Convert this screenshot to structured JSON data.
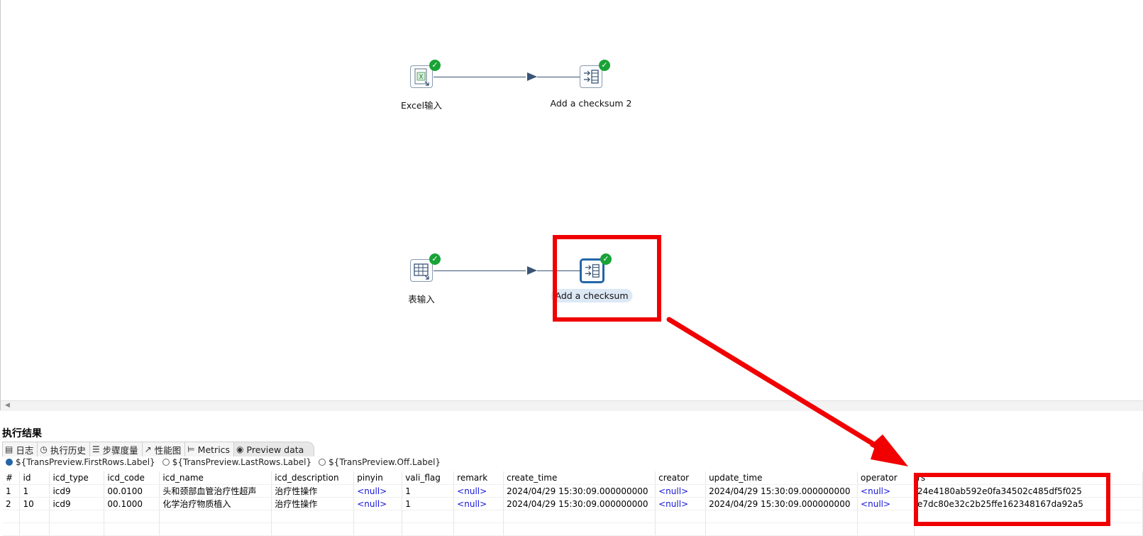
{
  "canvas": {
    "steps": [
      {
        "label": "Excel输入",
        "icon": "excel-input-icon"
      },
      {
        "label": "Add a checksum 2",
        "icon": "checksum-icon"
      },
      {
        "label": "表输入",
        "icon": "table-input-icon"
      },
      {
        "label": "Add a checksum",
        "icon": "checksum-icon"
      }
    ],
    "status_icon": "check-circle-icon",
    "status_color": "#19a337",
    "selected_color": "#2366a8"
  },
  "results": {
    "title": "执行结果",
    "tabs": [
      {
        "label": "日志",
        "icon": "log-icon"
      },
      {
        "label": "执行历史",
        "icon": "history-icon"
      },
      {
        "label": "步骤度量",
        "icon": "step-metrics-icon"
      },
      {
        "label": "性能图",
        "icon": "performance-chart-icon"
      },
      {
        "label": "Metrics",
        "icon": "metrics-icon"
      },
      {
        "label": "Preview data",
        "icon": "eye-icon"
      }
    ],
    "radios": [
      {
        "label": "${TransPreview.FirstRows.Label}",
        "selected": true
      },
      {
        "label": "${TransPreview.LastRows.Label}",
        "selected": false
      },
      {
        "label": "${TransPreview.Off.Label}",
        "selected": false
      }
    ],
    "table": {
      "columns": [
        "#",
        "id",
        "icd_type",
        "icd_code",
        "icd_name",
        "icd_description",
        "pinyin",
        "vali_flag",
        "remark",
        "create_time",
        "creator",
        "update_time",
        "operator",
        "rs"
      ],
      "rows": [
        [
          "1",
          "1",
          "icd9",
          "00.0100",
          "头和颈部血管治疗性超声",
          "治疗性操作",
          "<null>",
          "1",
          "<null>",
          "2024/04/29 15:30:09.000000000",
          "<null>",
          "2024/04/29 15:30:09.000000000",
          "<null>",
          "24e4180ab592e0fa34502c485df5f025"
        ],
        [
          "2",
          "10",
          "icd9",
          "00.1000",
          "化学治疗物质植入",
          "治疗性操作",
          "<null>",
          "1",
          "<null>",
          "2024/04/29 15:30:09.000000000",
          "<null>",
          "2024/04/29 15:30:09.000000000",
          "<null>",
          "e7dc80e32c2b25ffe162348167da92a5"
        ]
      ]
    }
  },
  "annotation_color": "#f00000"
}
